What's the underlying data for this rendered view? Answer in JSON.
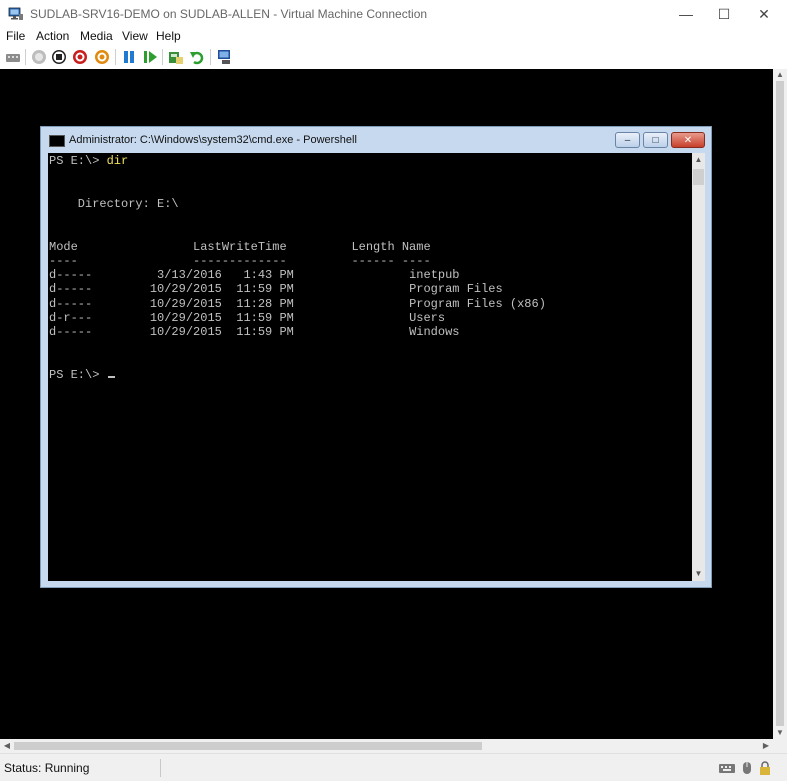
{
  "window": {
    "title": "SUDLAB-SRV16-DEMO on SUDLAB-ALLEN - Virtual Machine Connection",
    "minimize_glyph": "—",
    "maximize_glyph": "☐",
    "close_glyph": "✕"
  },
  "menu": {
    "items": [
      "File",
      "Action",
      "Media",
      "View",
      "Help"
    ]
  },
  "toolbar": {
    "icons": [
      "ctrl-alt-del-icon",
      "start-icon",
      "turn-off-icon",
      "shut-down-icon",
      "save-icon",
      "pause-icon",
      "resume-icon",
      "checkpoint-icon",
      "revert-icon",
      "enhanced-session-icon"
    ]
  },
  "cmd": {
    "title": "Administrator: C:\\Windows\\system32\\cmd.exe - Powershell",
    "min_glyph": "–",
    "max_glyph": "□",
    "close_glyph": "✕",
    "prompt1": "PS E:\\> ",
    "command1": "dir",
    "directory_line": "    Directory: E:\\",
    "header_line": "Mode                LastWriteTime         Length Name",
    "underline_line": "----                -------------         ------ ----",
    "rows": [
      {
        "mode": "d-----",
        "date": "3/13/2016",
        "time": "1:43 PM",
        "name": "inetpub"
      },
      {
        "mode": "d-----",
        "date": "10/29/2015",
        "time": "11:59 PM",
        "name": "Program Files"
      },
      {
        "mode": "d-----",
        "date": "10/29/2015",
        "time": "11:28 PM",
        "name": "Program Files (x86)"
      },
      {
        "mode": "d-r---",
        "date": "10/29/2015",
        "time": "11:59 PM",
        "name": "Users"
      },
      {
        "mode": "d-----",
        "date": "10/29/2015",
        "time": "11:59 PM",
        "name": "Windows"
      }
    ],
    "prompt2": "PS E:\\> "
  },
  "status": {
    "text": "Status: Running"
  },
  "colors": {
    "console_bg": "#000000",
    "console_fg": "#c0c0c0",
    "command_fg": "#f0e060",
    "vm_bg": "#000000"
  }
}
